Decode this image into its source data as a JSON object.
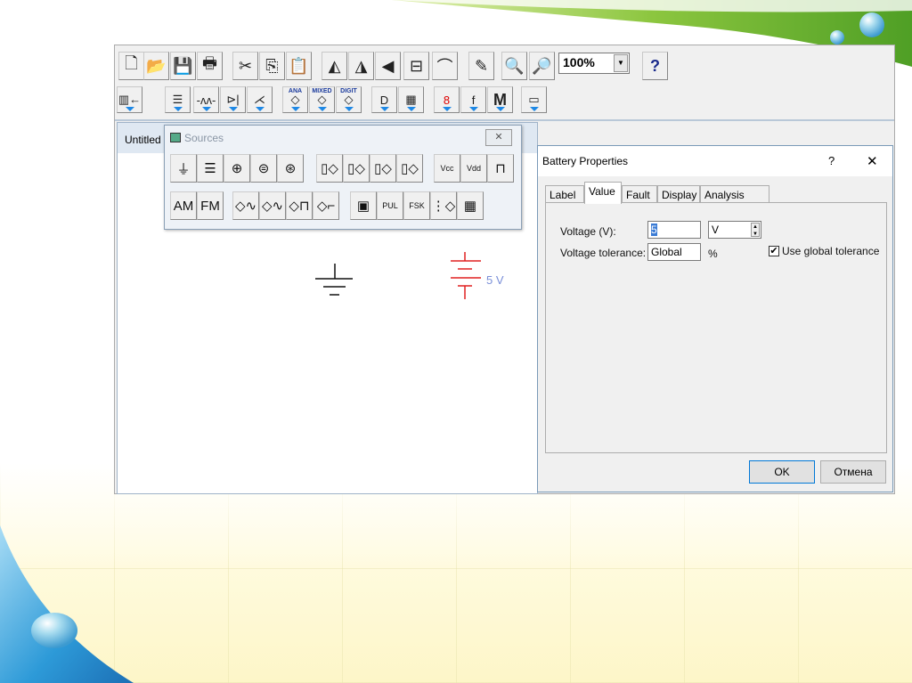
{
  "toolbar_main": {
    "buttons": [
      {
        "name": "new-icon",
        "glyph": "🗋"
      },
      {
        "name": "open-icon",
        "glyph": "📂"
      },
      {
        "name": "save-icon",
        "glyph": "💾"
      },
      {
        "name": "print-icon",
        "glyph": "🖶"
      },
      {
        "name": "cut-icon",
        "glyph": "✂"
      },
      {
        "name": "copy-icon",
        "glyph": "⎘"
      },
      {
        "name": "paste-icon",
        "glyph": "📋"
      },
      {
        "name": "rotate-icon",
        "glyph": "◭"
      },
      {
        "name": "flip-horizontal-icon",
        "glyph": "◮"
      },
      {
        "name": "flip-vertical-icon",
        "glyph": "◀"
      },
      {
        "name": "subcircuit-icon",
        "glyph": "⊟"
      },
      {
        "name": "graph-icon",
        "glyph": "⌒"
      },
      {
        "name": "description-edit-icon",
        "glyph": "✎"
      },
      {
        "name": "zoom-out-icon",
        "glyph": "🔍"
      },
      {
        "name": "zoom-in-icon",
        "glyph": "🔎"
      }
    ],
    "zoom_value": "100%",
    "help_label": "?"
  },
  "toolbar_parts": {
    "buttons": [
      {
        "name": "favorites-icon",
        "glyph": "▥←",
        "mini": ""
      },
      {
        "name": "sources-icon",
        "glyph": "☰",
        "mini": ""
      },
      {
        "name": "basic-icon",
        "glyph": "-ʌʌ-",
        "mini": ""
      },
      {
        "name": "diodes-icon",
        "glyph": "⊳|",
        "mini": ""
      },
      {
        "name": "transistors-icon",
        "glyph": "⋌",
        "mini": ""
      },
      {
        "name": "analog-ics-icon",
        "glyph": "◇",
        "mini": "ANA"
      },
      {
        "name": "mixed-ics-icon",
        "glyph": "◇",
        "mini": "MIXED"
      },
      {
        "name": "digital-ics-icon",
        "glyph": "◇",
        "mini": "DIGIT"
      },
      {
        "name": "logic-gates-icon",
        "glyph": "D",
        "mini": ""
      },
      {
        "name": "digital-icon",
        "glyph": "▦",
        "mini": ""
      },
      {
        "name": "indicators-icon",
        "glyph": "8",
        "mini": ""
      },
      {
        "name": "controls-icon",
        "glyph": "f",
        "mini": ""
      },
      {
        "name": "miscellaneous-icon",
        "glyph": "M",
        "mini": ""
      },
      {
        "name": "instruments-icon",
        "glyph": "▭",
        "mini": ""
      }
    ]
  },
  "circuit_window": {
    "title": "Untitled",
    "battery_label": "5 V"
  },
  "sources_palette": {
    "title": "Sources",
    "close": "✕",
    "row1": [
      "⏚",
      "☰",
      "⊕",
      "⊜",
      "⊛",
      "▯◇",
      "▯◇",
      "▯◇",
      "▯◇",
      "Vcc",
      "Vdd",
      "⊓"
    ],
    "row2": [
      "AM",
      "FM",
      "◇∿",
      "◇∿",
      "◇⊓",
      "◇⌐",
      "▣",
      "PUL",
      "FSK",
      "⋮◇",
      "▦"
    ]
  },
  "battery_dialog": {
    "title": "Battery Properties",
    "help": "?",
    "close": "✕",
    "tabs": [
      "Label",
      "Value",
      "Fault",
      "Display",
      "Analysis Setup"
    ],
    "active_tab": "Value",
    "voltage_label": "Voltage (V):",
    "voltage_value": "5",
    "voltage_unit": "V",
    "tolerance_label": "Voltage tolerance:",
    "tolerance_value": "Global",
    "tolerance_unit": "%",
    "use_global_label": "Use global tolerance",
    "use_global_checked": true,
    "ok": "OK",
    "cancel": "Отмена"
  },
  "colors": {
    "battery": "#e02020",
    "label": "#7a8fd8",
    "accent_arrow": "#1e88e5"
  }
}
